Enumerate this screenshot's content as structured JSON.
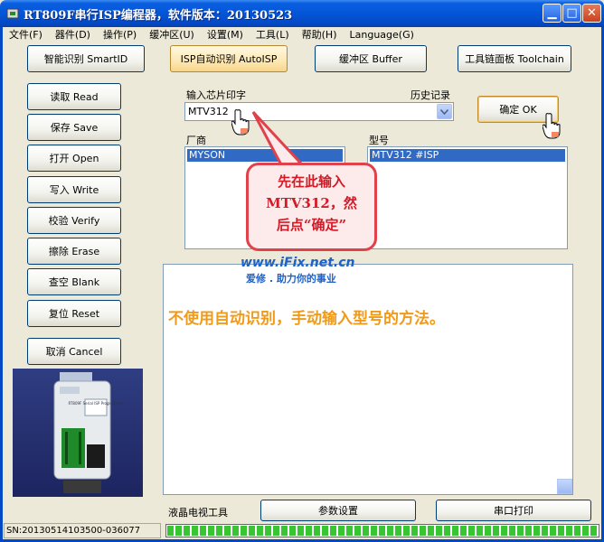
{
  "window": {
    "title": "RT809F串行ISP编程器，软件版本：20130523",
    "colors": {
      "titlebar": "#0455d8",
      "callout_text": "#d41a26",
      "message": "#f09a1a",
      "watermark": "#1d62c8"
    }
  },
  "menu": {
    "items": [
      {
        "label": "文件(F)"
      },
      {
        "label": "器件(D)"
      },
      {
        "label": "操作(P)"
      },
      {
        "label": "缓冲区(U)"
      },
      {
        "label": "设置(M)"
      },
      {
        "label": "工具(L)"
      },
      {
        "label": "帮助(H)"
      },
      {
        "label": "Language(G)"
      }
    ]
  },
  "tabs": {
    "smart_id": "智能识别 SmartID",
    "auto_isp": "ISP自动识别 AutoISP",
    "buffer": "缓冲区 Buffer",
    "toolchain": "工具链面板 Toolchain"
  },
  "actions": {
    "read": "读取 Read",
    "save": "保存 Save",
    "open": "打开 Open",
    "write": "写入 Write",
    "verify": "校验 Verify",
    "erase": "擦除 Erase",
    "blank": "查空 Blank",
    "reset": "复位 Reset",
    "cancel": "取消 Cancel"
  },
  "chip_input": {
    "label": "输入芯片印字",
    "history_label": "历史记录",
    "value": "MTV312",
    "ok_button": "确定 OK"
  },
  "vendor_list": {
    "header": "厂商",
    "selected": "MYSON"
  },
  "model_list": {
    "header": "型号",
    "selected": "MTV312 #ISP"
  },
  "callout": {
    "line1": "先在此输入",
    "line2": "MTV312，然",
    "line3": "后点“确定”"
  },
  "watermark": {
    "url": "www.iFix.net.cn",
    "slogan": "爱修 . 助力你的事业"
  },
  "message": "不使用自动识别，手动输入型号的方法。",
  "device_photo": {
    "label": "RT809F Serial ISP Programmer"
  },
  "bottom": {
    "lcd_tools": "液晶电视工具",
    "params_button": "参数设置",
    "print_button": "串口打印"
  },
  "status": {
    "serial": "SN:20130514103500-036077",
    "progress_fraction": 1.0
  }
}
